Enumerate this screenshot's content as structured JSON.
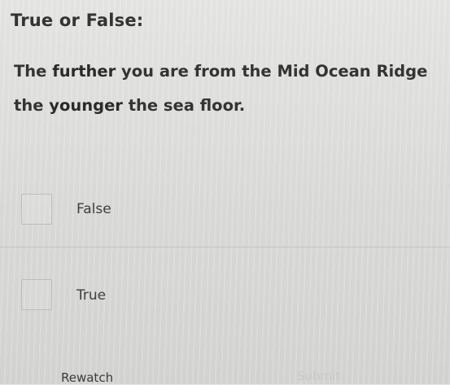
{
  "question": {
    "label": "True or False:",
    "line1": {
      "prefix": "The",
      "emphasis": "further",
      "suffix": "you are from the Mid Ocean Ridge"
    },
    "line2": {
      "prefix": "the",
      "emphasis": "younger",
      "suffix": "the sea floor."
    }
  },
  "options": [
    {
      "label": "False",
      "checked": false
    },
    {
      "label": "True",
      "checked": false
    }
  ],
  "footer": {
    "rewatch_label": "Rewatch",
    "submit_label": "Submit"
  }
}
